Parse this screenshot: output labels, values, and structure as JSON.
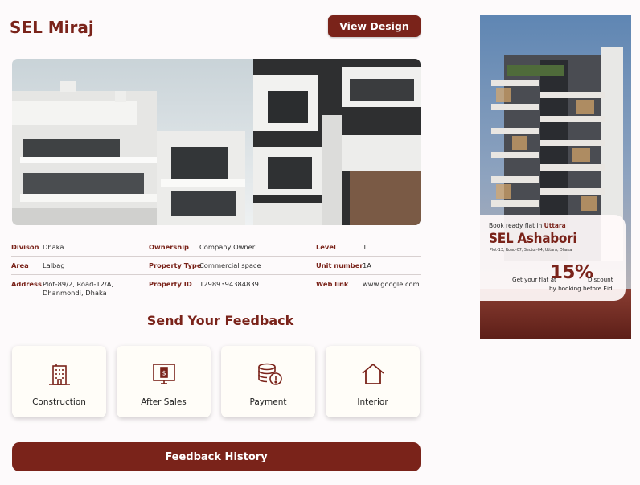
{
  "header": {
    "title": "SEL Miraj",
    "view_design_label": "View Design"
  },
  "property": {
    "rows": [
      [
        {
          "label": "Divison",
          "value": "Dhaka"
        },
        {
          "label": "Ownership",
          "value": "Company Owner"
        },
        {
          "label": "Level",
          "value": "1"
        }
      ],
      [
        {
          "label": "Area",
          "value": "Lalbag"
        },
        {
          "label": "Property Type",
          "value": "Commercial space"
        },
        {
          "label": "Unit number",
          "value": "1A"
        }
      ],
      [
        {
          "label": "Address",
          "value": "Plot-89/2, Road-12/A, Dhanmondi, Dhaka"
        },
        {
          "label": "Property ID",
          "value": "12989394384839"
        },
        {
          "label": "Web link",
          "value": "www.google.com"
        }
      ]
    ]
  },
  "feedback": {
    "heading": "Send Your Feedback",
    "cards": [
      {
        "label": "Construction",
        "icon": "building-icon"
      },
      {
        "label": "After Sales",
        "icon": "monitor-dollar-icon"
      },
      {
        "label": "Payment",
        "icon": "coins-icon"
      },
      {
        "label": "Interior",
        "icon": "house-icon"
      }
    ],
    "history_label": "Feedback History"
  },
  "ad": {
    "line1_prefix": "Book ready flat in",
    "line1_place": "Uttara",
    "project": "SEL Ashabori",
    "address": "Plot-13, Road-07, Sector-04, Uttara, Dhaka",
    "offer_prefix": "Get your flat at",
    "offer_percent": "15%",
    "offer_suffix": "Discount",
    "offer_note": "by booking before Eid."
  },
  "colors": {
    "accent": "#7a231a",
    "background": "#fdfafb",
    "card": "#fffdf8"
  }
}
